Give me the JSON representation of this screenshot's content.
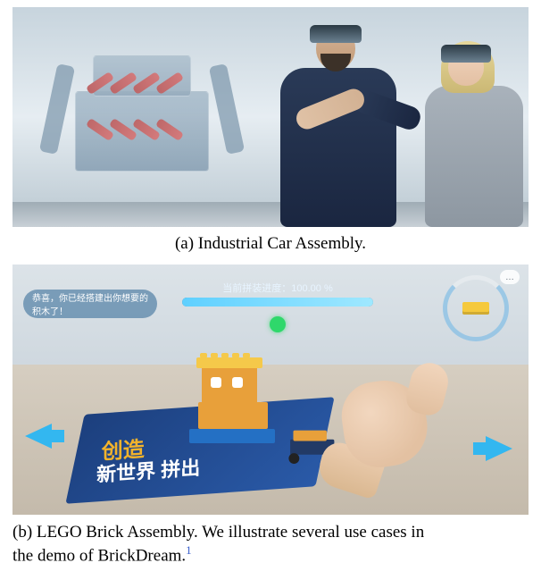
{
  "captions": {
    "a": "(a) Industrial Car Assembly.",
    "b_line1": "(b) LEGO Brick Assembly. We illustrate several use cases in",
    "b_line2_prefix": "the demo of BrickDream.",
    "b_footref": "1"
  },
  "panel_b": {
    "hint_left": "恭喜，你已经搭建出你想要的积木了！",
    "progress_label": "当前拼装进度：100.00 %",
    "progress_percent": 100,
    "card_line1": "创造",
    "card_line2": "新世界 拼出",
    "chat_glyph": "…"
  }
}
